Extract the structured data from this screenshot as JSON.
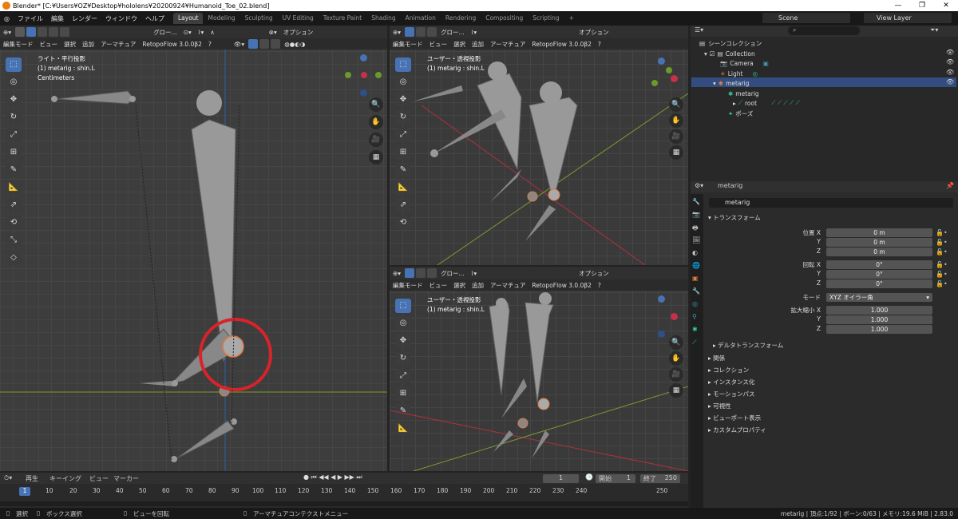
{
  "window": {
    "title": "Blender* [C:¥Users¥OZ¥Desktop¥hololens¥20200924¥Humanoid_Toe_02.blend]",
    "min": "—",
    "max": "❐",
    "close": "✕"
  },
  "menu": [
    "ファイル",
    "編集",
    "レンダー",
    "ウィンドウ",
    "ヘルプ"
  ],
  "workspaces": [
    "Layout",
    "Modeling",
    "Sculpting",
    "UV Editing",
    "Texture Paint",
    "Shading",
    "Animation",
    "Rendering",
    "Compositing",
    "Scripting"
  ],
  "scene": {
    "label": "Scene",
    "view_layer": "View Layer"
  },
  "viewport_header": {
    "mode": "編集モード",
    "view": "ビュー",
    "select": "選択",
    "add": "追加",
    "armature": "アーマチュア",
    "retopo": "RetopoFlow 3.0.0β2",
    "transform": "グロー...",
    "options": "オプション"
  },
  "viewports": [
    {
      "line1": "ライト・平行投影",
      "line2": "(1) metarig : shin.L",
      "line3": "Centimeters"
    },
    {
      "line1": "ユーザー・透視投影",
      "line2": "(1) metarig : shin.L"
    },
    {
      "line1": "ユーザー・透視投影",
      "line2": "(1) metarig : shin.L"
    }
  ],
  "outliner": {
    "search_placeholder": "",
    "rows": [
      {
        "label": "シーンコレクション"
      },
      {
        "label": "Collection"
      },
      {
        "label": "Camera"
      },
      {
        "label": "Light"
      },
      {
        "label": "metarig"
      },
      {
        "label": "metarig"
      },
      {
        "label": "root"
      },
      {
        "label": "ポーズ"
      }
    ]
  },
  "properties": {
    "object_name": "metarig",
    "data_name": "metarig",
    "transform_header": "トランスフォーム",
    "location_label": "位置 X",
    "rotation_label": "回転 X",
    "scale_label": "拡大縮小 X",
    "axis_y": "Y",
    "axis_z": "Z",
    "loc": [
      "0 m",
      "0 m",
      "0 m"
    ],
    "rot": [
      "0°",
      "0°",
      "0°"
    ],
    "mode_label": "モード",
    "mode_value": "XYZ オイラー角",
    "scale": [
      "1.000",
      "1.000",
      "1.000"
    ],
    "delta": "デルタトランスフォーム",
    "panels": [
      "関係",
      "コレクション",
      "インスタンス化",
      "モーションパス",
      "可視性",
      "ビューポート表示",
      "カスタムプロパティ"
    ]
  },
  "timeline": {
    "play": "再生",
    "keying": "キーイング",
    "view": "ビュー",
    "marker": "マーカー",
    "current": "1",
    "start_label": "開始",
    "start": "1",
    "end_label": "終了",
    "end": "250",
    "ticks": [
      "1",
      "10",
      "20",
      "30",
      "40",
      "50",
      "60",
      "70",
      "80",
      "90",
      "100",
      "110",
      "120",
      "130",
      "140",
      "150",
      "160",
      "170",
      "180",
      "190",
      "200",
      "210",
      "220",
      "230",
      "240",
      "250"
    ]
  },
  "status": {
    "select": "選択",
    "box": "ボックス選択",
    "rotate": "ビューを回転",
    "context": "アーマチュアコンテクストメニュー",
    "info": "metarig | 頂点:1/92 | ボーン:0/63 | メモリ:19.6 MiB | 2.83.0"
  }
}
